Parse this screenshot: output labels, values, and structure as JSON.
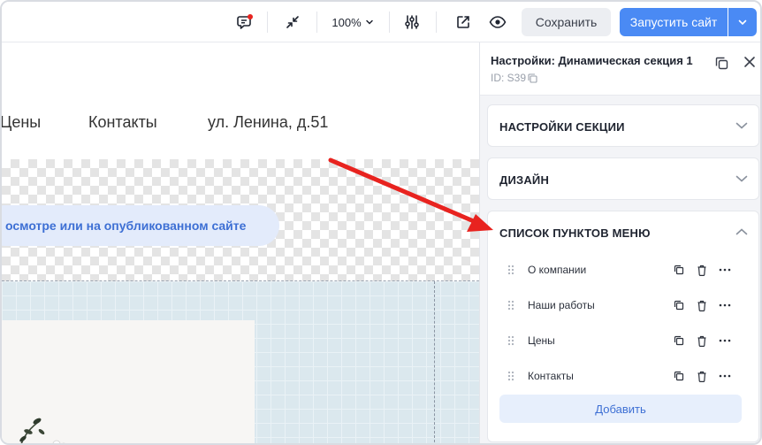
{
  "toolbar": {
    "zoom_value": "100%",
    "save_label": "Сохранить",
    "launch_label": "Запустить сайт"
  },
  "canvas": {
    "nav_items": [
      "Цены",
      "Контакты",
      "ул. Ленина, д.51"
    ],
    "preview_notice": "осмотре или на опубликованном сайте"
  },
  "panel": {
    "title": "Настройки: Динамическая секция 1",
    "id_text": "ID: S39",
    "sections": [
      {
        "title": "НАСТРОЙКИ СЕКЦИИ",
        "expanded": false
      },
      {
        "title": "ДИЗАЙН",
        "expanded": false
      },
      {
        "title": "СПИСОК ПУНКТОВ МЕНЮ",
        "expanded": true
      }
    ],
    "menu_items": [
      {
        "label": "О компании"
      },
      {
        "label": "Наши работы"
      },
      {
        "label": "Цены"
      },
      {
        "label": "Контакты"
      }
    ],
    "add_label": "Добавить"
  },
  "colors": {
    "accent": "#4a8af4",
    "annotation_arrow": "#e8231f",
    "notification_dot": "#e8231f"
  }
}
